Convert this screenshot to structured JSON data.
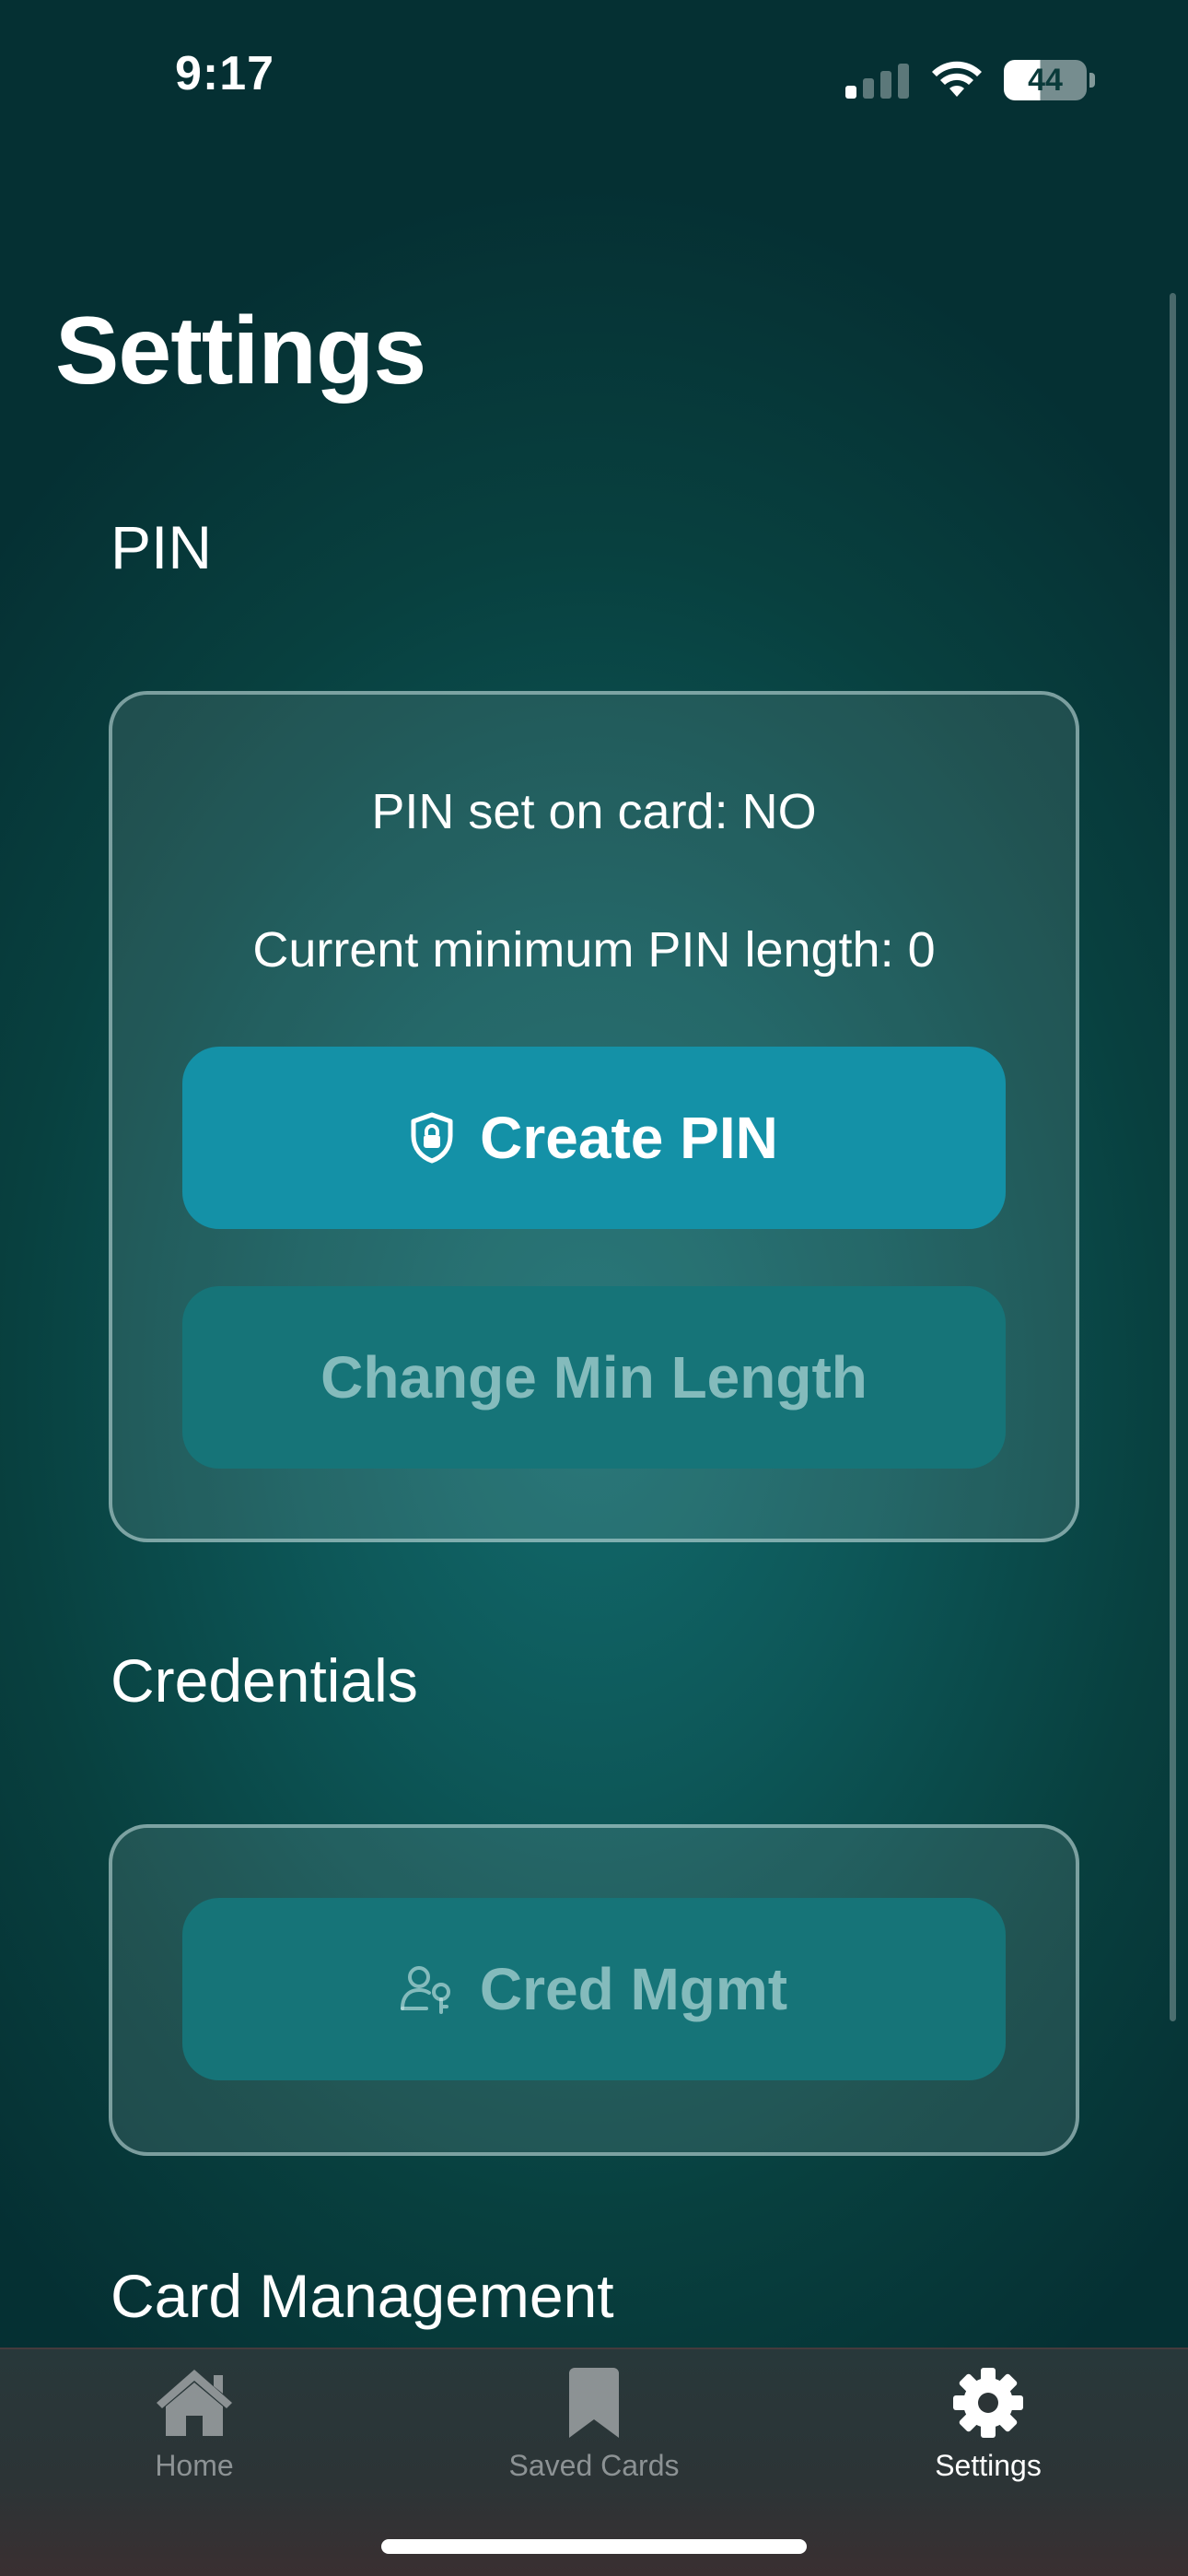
{
  "status_bar": {
    "time": "9:17",
    "battery": "44"
  },
  "page": {
    "title": "Settings"
  },
  "sections": {
    "pin": {
      "header": "PIN",
      "pin_set_text": "PIN set on card: NO",
      "min_length_text": "Current minimum PIN length: 0",
      "create_button": "Create PIN",
      "create_icon": "shield-lock-icon",
      "change_button": "Change Min Length"
    },
    "credentials": {
      "header": "Credentials",
      "cred_button": "Cred Mgmt",
      "cred_icon": "person-key-icon"
    },
    "card_management": {
      "header": "Card Management"
    }
  },
  "tab_bar": {
    "tabs": [
      {
        "label": "Home",
        "icon": "house-icon",
        "active": false
      },
      {
        "label": "Saved Cards",
        "icon": "bookmark-icon",
        "active": false
      },
      {
        "label": "Settings",
        "icon": "gear-icon",
        "active": true
      }
    ]
  },
  "colors": {
    "primary_button": "#1491a7",
    "disabled_button": "#167478",
    "active_tab": "#ffffff",
    "inactive_tab": "#8c9294"
  }
}
